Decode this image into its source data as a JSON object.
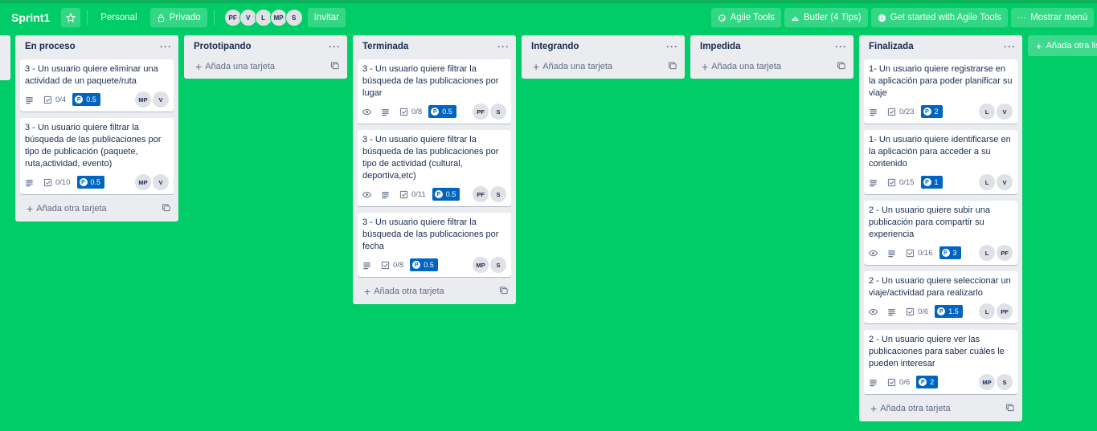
{
  "board": {
    "title": "Sprint1",
    "team_label": "Personal",
    "visibility_label": "Privado",
    "members": [
      "PF",
      "V",
      "L",
      "MP",
      "S"
    ],
    "invite_label": "Invitar",
    "right_buttons": [
      {
        "label": "Agile Tools",
        "icon": "agile-tools-icon"
      },
      {
        "label": "Butler (4 Tips)",
        "icon": "butler-icon"
      },
      {
        "label": "Get started with Agile Tools",
        "icon": "info-icon"
      },
      {
        "label": "Mostrar menú",
        "icon": "more-icon"
      }
    ]
  },
  "colors": {
    "background": "#00cd68",
    "list_bg": "#ebecf0",
    "points_badge": "#0065c0"
  },
  "lists": [
    {
      "title": "En proceso",
      "add_label": "Añada otra tarjeta",
      "cards": [
        {
          "title": "3 - Un usuario quiere eliminar una actividad de un paquete/ruta",
          "watch": false,
          "checklist": "0/4",
          "points": "0.5",
          "members": [
            "MP",
            "V"
          ]
        },
        {
          "title": "3 - Un usuario quiere filtrar la búsqueda de las publicaciones por tipo de publicación (paquete, ruta,actividad, evento)",
          "watch": false,
          "checklist": "0/10",
          "points": "0.5",
          "members": [
            "MP",
            "V"
          ]
        }
      ]
    },
    {
      "title": "Prototipando",
      "add_label": "Añada una tarjeta",
      "cards": []
    },
    {
      "title": "Terminada",
      "add_label": "Añada otra tarjeta",
      "cards": [
        {
          "title": "3 - Un usuario quiere filtrar la búsqueda de las publicaciones por lugar",
          "watch": true,
          "checklist": "0/8",
          "points": "0.5",
          "members": [
            "PF",
            "S"
          ]
        },
        {
          "title": "3 - Un usuario quiere filtrar la búsqueda de las publicaciones por tipo de actividad (cultural, deportiva,etc)",
          "watch": true,
          "checklist": "0/11",
          "points": "0.5",
          "members": [
            "PF",
            "S"
          ]
        },
        {
          "title": "3 - Un usuario quiere filtrar la búsqueda de las publicaciones por fecha",
          "watch": false,
          "checklist": "0/8",
          "points": "0.5",
          "members": [
            "MP",
            "S"
          ]
        }
      ]
    },
    {
      "title": "Integrando",
      "add_label": "Añada una tarjeta",
      "cards": []
    },
    {
      "title": "Impedida",
      "add_label": "Añada una tarjeta",
      "cards": []
    },
    {
      "title": "Finalizada",
      "add_label": "Añada otra tarjeta",
      "cards": [
        {
          "title": "1- Un usuario quiere registrarse en la aplicación para poder planificar su viaje",
          "watch": false,
          "checklist": "0/23",
          "points": "2",
          "members": [
            "L",
            "V"
          ]
        },
        {
          "title": "1- Un usuario quiere identificarse en la aplicación para acceder a su contenido",
          "watch": false,
          "checklist": "0/15",
          "points": "1",
          "members": [
            "L",
            "V"
          ]
        },
        {
          "title": "2 - Un usuario quiere subir una publicación para compartir su experiencia",
          "watch": true,
          "checklist": "0/16",
          "points": "3",
          "members": [
            "L",
            "PF"
          ]
        },
        {
          "title": "2 - Un usuario quiere seleccionar un viaje/actividad para realizarlo",
          "watch": true,
          "checklist": "0/6",
          "points": "1.5",
          "members": [
            "L",
            "PF"
          ]
        },
        {
          "title": "2 - Un usuario quiere ver las publicaciones para saber cuáles le pueden interesar",
          "watch": false,
          "checklist": "0/6",
          "points": "2",
          "members": [
            "MP",
            "S"
          ]
        }
      ]
    }
  ],
  "add_list_label": "Añada otra lista"
}
